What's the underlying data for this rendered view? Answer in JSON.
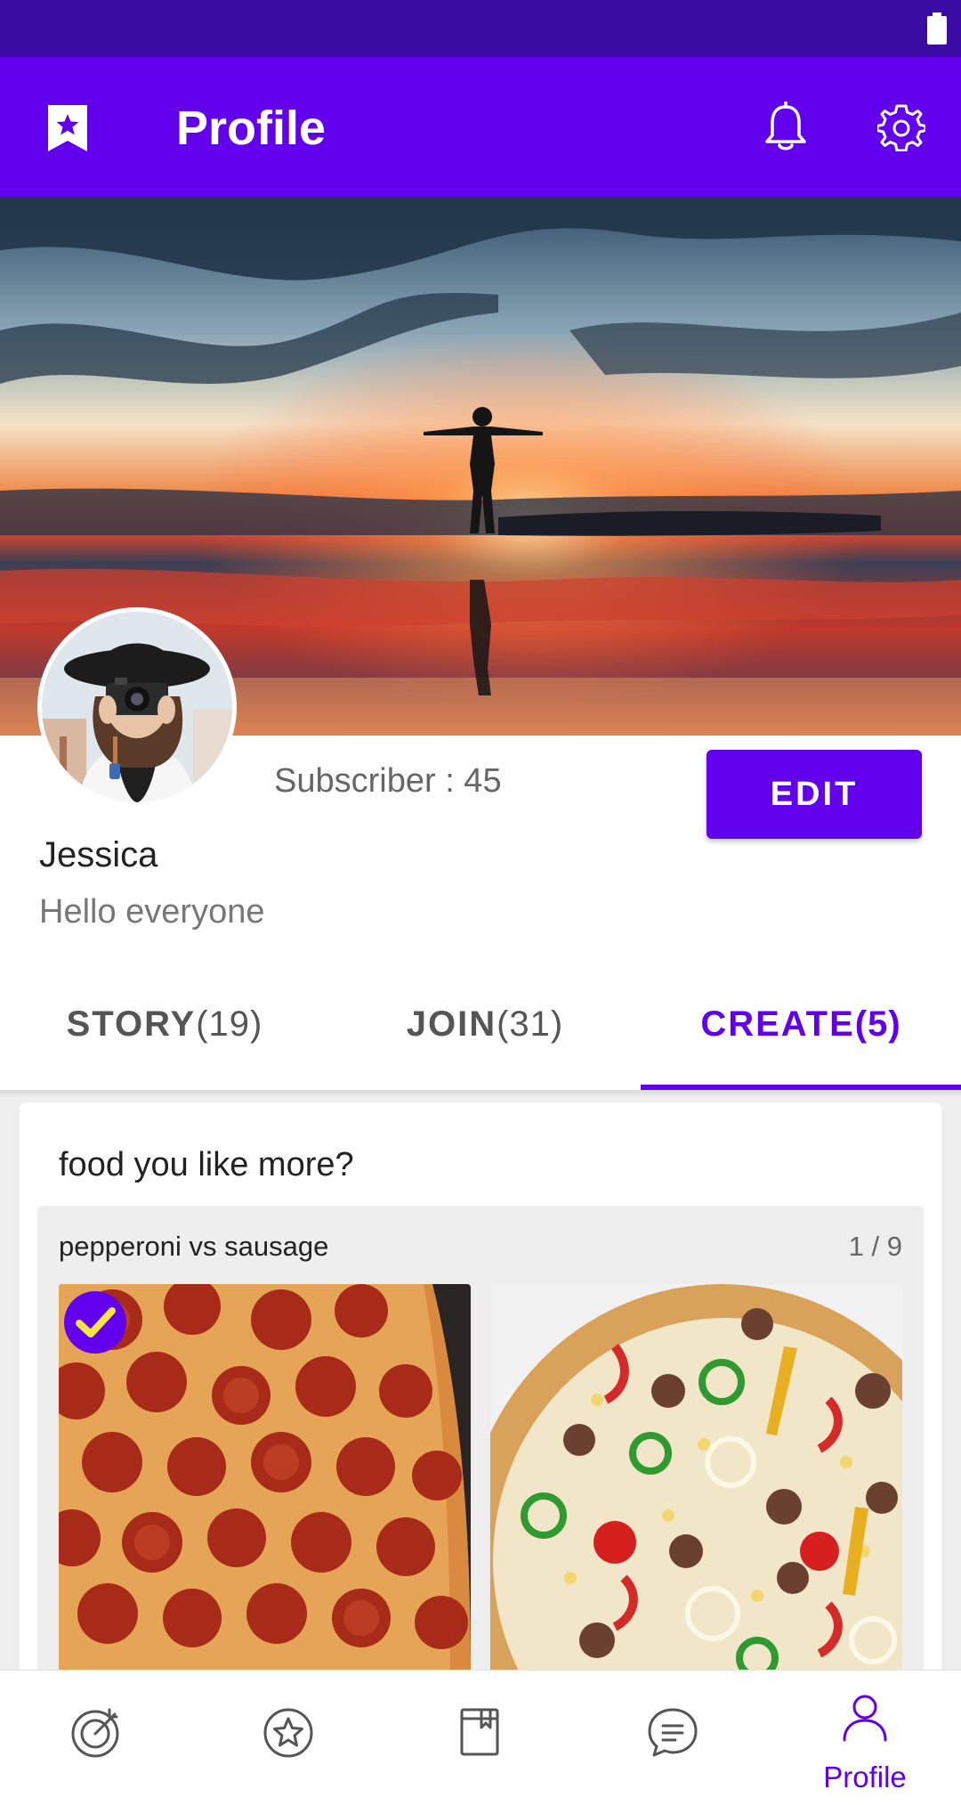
{
  "colors": {
    "primary": "#6200ee",
    "status_bar": "#3a0ca3",
    "white": "#ffffff",
    "text_secondary": "#666666"
  },
  "status_bar": {
    "icons": [
      "battery-icon"
    ]
  },
  "app_bar": {
    "title": "Profile",
    "left_icon": "bookmark-star-icon",
    "right_icons": [
      "bell-icon",
      "gear-icon"
    ]
  },
  "cover_image": {
    "description": "silhouette at sunset over water"
  },
  "profile": {
    "subscriber_label": "Subscriber : 45",
    "edit_label": "EDIT",
    "name": "Jessica",
    "bio": "Hello everyone"
  },
  "tabs": [
    {
      "label": "STORY",
      "count": "(19)",
      "active": false
    },
    {
      "label": "JOIN",
      "count": "(31)",
      "active": false
    },
    {
      "label": "CREATE",
      "count": "(5)",
      "active": true
    }
  ],
  "post": {
    "title": "food you like more?",
    "poll": {
      "question": "pepperoni vs sausage",
      "page": "1 / 9",
      "options": [
        {
          "image": "pepperoni pizza",
          "selected": true
        },
        {
          "image": "sausage pizza",
          "selected": false
        }
      ]
    }
  },
  "bottom_nav": [
    {
      "icon": "target-icon",
      "label": ""
    },
    {
      "icon": "star-icon",
      "label": ""
    },
    {
      "icon": "book-icon",
      "label": ""
    },
    {
      "icon": "chat-icon",
      "label": ""
    },
    {
      "icon": "person-icon",
      "label": "Profile",
      "active": true
    }
  ]
}
